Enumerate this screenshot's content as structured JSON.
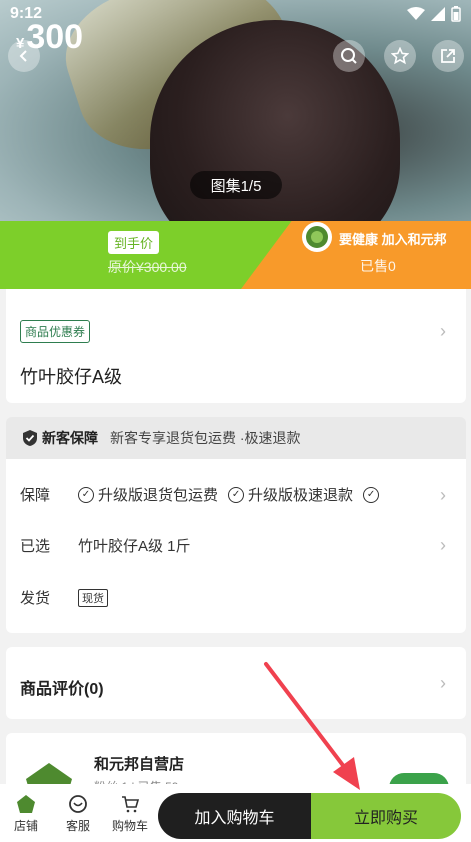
{
  "status_bar": {
    "time": "9:12"
  },
  "gallery": {
    "badge": "图集1/5"
  },
  "price": {
    "currency": "¥",
    "value": "300",
    "tag": "到手价",
    "original": "原价¥300.00"
  },
  "brand": {
    "slogan": "要健康 加入和元邦",
    "sold": "已售0"
  },
  "coupon": {
    "tag": "商品优惠券"
  },
  "product": {
    "title": "竹叶胶仔A级"
  },
  "guarantee": {
    "title": "新客保障",
    "subtitle": "新客专享退货包运费 ·极速退款"
  },
  "details": {
    "guarantee_label": "保障",
    "guarantee_items": [
      "升级版退货包运费",
      "升级版极速退款"
    ],
    "selected_label": "已选",
    "selected_value": "竹叶胶仔A级 1斤",
    "shipping_label": "发货",
    "shipping_tag": "现货"
  },
  "reviews": {
    "title": "商品评价(0)"
  },
  "store": {
    "name": "和元邦自营店",
    "meta": "粉丝 1 | 已售 59"
  },
  "bottom_bar": {
    "tabs": [
      {
        "label": "店铺",
        "icon": "store-icon"
      },
      {
        "label": "客服",
        "icon": "chat-icon"
      },
      {
        "label": "购物车",
        "icon": "cart-icon"
      }
    ],
    "add_to_cart": "加入购物车",
    "buy_now": "立即购买"
  },
  "colors": {
    "green": "#7dcf2a",
    "orange": "#f89a2a",
    "buy": "#86c83a",
    "dark": "#1f1f1f",
    "arrow": "#f0414f"
  }
}
